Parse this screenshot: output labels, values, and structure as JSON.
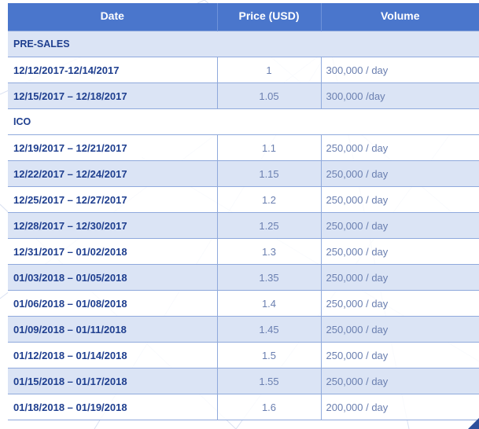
{
  "colors": {
    "header_bg": "#4a76cc",
    "header_text": "#ffffff",
    "row_alt_bg": "#dbe4f5",
    "date_text": "#1f3f8f",
    "value_text": "#6a7fb0",
    "grid_line": "#8fa9dc"
  },
  "table": {
    "headers": [
      "Date",
      "Price (USD)",
      "Volume"
    ],
    "sections": [
      {
        "title": "PRE-SALES",
        "rows": [
          {
            "date": "12/12/2017-12/14/2017",
            "price": "1",
            "volume": "300,000 / day"
          },
          {
            "date": "12/15/2017 – 12/18/2017",
            "price": "1.05",
            "volume": "300,000 /day"
          }
        ]
      },
      {
        "title": "ICO",
        "rows": [
          {
            "date": "12/19/2017 – 12/21/2017",
            "price": "1.1",
            "volume": "250,000 / day"
          },
          {
            "date": "12/22/2017 – 12/24/2017",
            "price": "1.15",
            "volume": "250,000 / day"
          },
          {
            "date": "12/25/2017 – 12/27/2017",
            "price": "1.2",
            "volume": "250,000 / day"
          },
          {
            "date": "12/28/2017 – 12/30/2017",
            "price": "1.25",
            "volume": "250,000 / day"
          },
          {
            "date": "12/31/2017 – 01/02/2018",
            "price": "1.3",
            "volume": "250,000 / day"
          },
          {
            "date": "01/03/2018 – 01/05/2018",
            "price": "1.35",
            "volume": "250,000 / day"
          },
          {
            "date": "01/06/2018 – 01/08/2018",
            "price": "1.4",
            "volume": "250,000 / day"
          },
          {
            "date": "01/09/2018 – 01/11/2018",
            "price": "1.45",
            "volume": "250,000 / day"
          },
          {
            "date": "01/12/2018 – 01/14/2018",
            "price": "1.5",
            "volume": "250,000 / day"
          },
          {
            "date": "01/15/2018 – 01/17/2018",
            "price": "1.55",
            "volume": "250,000 / day"
          },
          {
            "date": "01/18/2018 – 01/19/2018",
            "price": "1.6",
            "volume": "200,000 / day"
          }
        ]
      }
    ]
  }
}
